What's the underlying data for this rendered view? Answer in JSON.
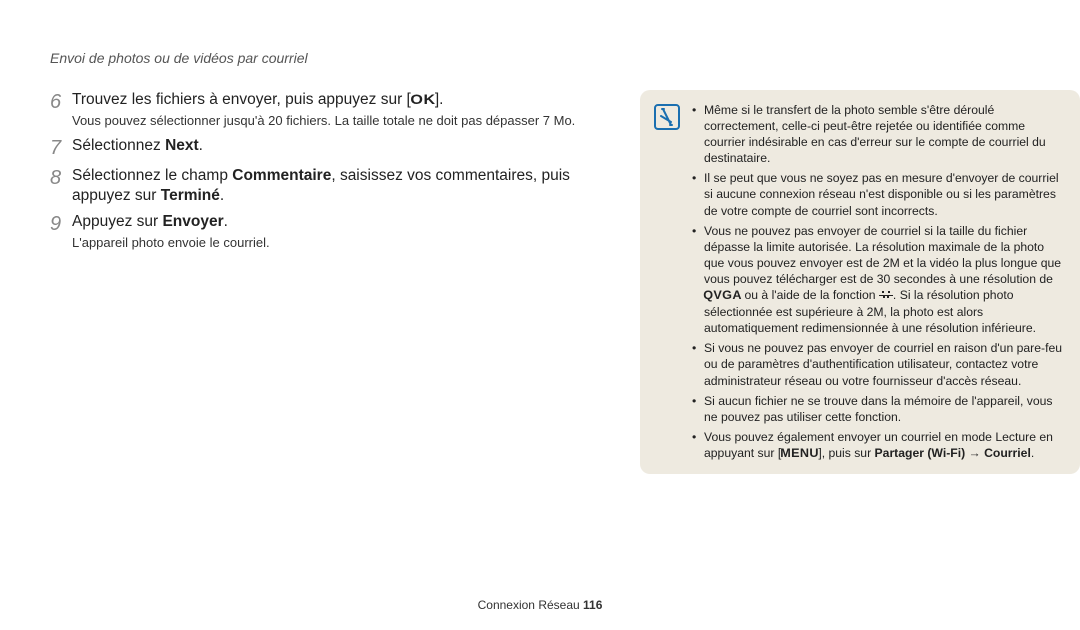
{
  "header": "Envoi de photos ou de vidéos par courriel",
  "steps": {
    "s6": {
      "num": "6",
      "main_a": "Trouvez les fichiers à envoyer, puis appuyez sur [",
      "ok_icon": "OK",
      "main_b": "].",
      "sub": "Vous pouvez sélectionner jusqu'à 20 fichiers. La taille totale ne doit pas dépasser 7 Mo."
    },
    "s7": {
      "num": "7",
      "main_a": "Sélectionnez ",
      "bold_next": "Next",
      "main_b": "."
    },
    "s8": {
      "num": "8",
      "main_a": "Sélectionnez le champ ",
      "bold_comm": "Commentaire",
      "main_b": ", saisissez vos commentaires, puis appuyez sur ",
      "bold_term": "Terminé",
      "main_c": "."
    },
    "s9": {
      "num": "9",
      "main_a": "Appuyez sur ",
      "bold_env": "Envoyer",
      "main_b": ".",
      "sub": "L'appareil photo envoie le courriel."
    }
  },
  "note": {
    "b1": "Même si le transfert de la photo semble s'être déroulé correctement, celle-ci peut-être rejetée ou identifiée comme courrier indésirable en cas d'erreur sur le compte de courriel du destinataire.",
    "b2": "Il se peut que vous ne soyez pas en mesure d'envoyer de courriel si aucune connexion réseau n'est disponible ou si les paramètres de votre compte de courriel sont incorrects.",
    "b3_a": "Vous ne pouvez pas envoyer de courriel si la taille du fichier dépasse la limite autorisée. La résolution maximale de la photo que vous pouvez envoyer est de 2M et la vidéo la plus longue que vous pouvez télécharger est de 30 secondes à une résolution de ",
    "b3_qvga": "QVGA",
    "b3_b": " ou à l'aide de la fonction ",
    "b3_c": ". Si la résolution photo sélectionnée est supérieure à 2M, la photo est alors automatiquement redimensionnée à une résolution inférieure.",
    "b4": "Si vous ne pouvez pas envoyer de courriel en raison d'un pare-feu ou de paramètres d'authentification utilisateur, contactez votre administrateur réseau ou votre fournisseur d'accès réseau.",
    "b5": "Si aucun fichier ne se trouve dans la mémoire de l'appareil, vous ne pouvez pas utiliser cette fonction.",
    "b6_a": "Vous pouvez également envoyer un courriel en mode Lecture en appuyant sur [",
    "b6_menu": "MENU",
    "b6_b": "], puis sur ",
    "b6_bold": "Partager (Wi-Fi) → Courriel",
    "b6_c": "."
  },
  "footer": {
    "section": "Connexion Réseau  ",
    "page": "116"
  }
}
